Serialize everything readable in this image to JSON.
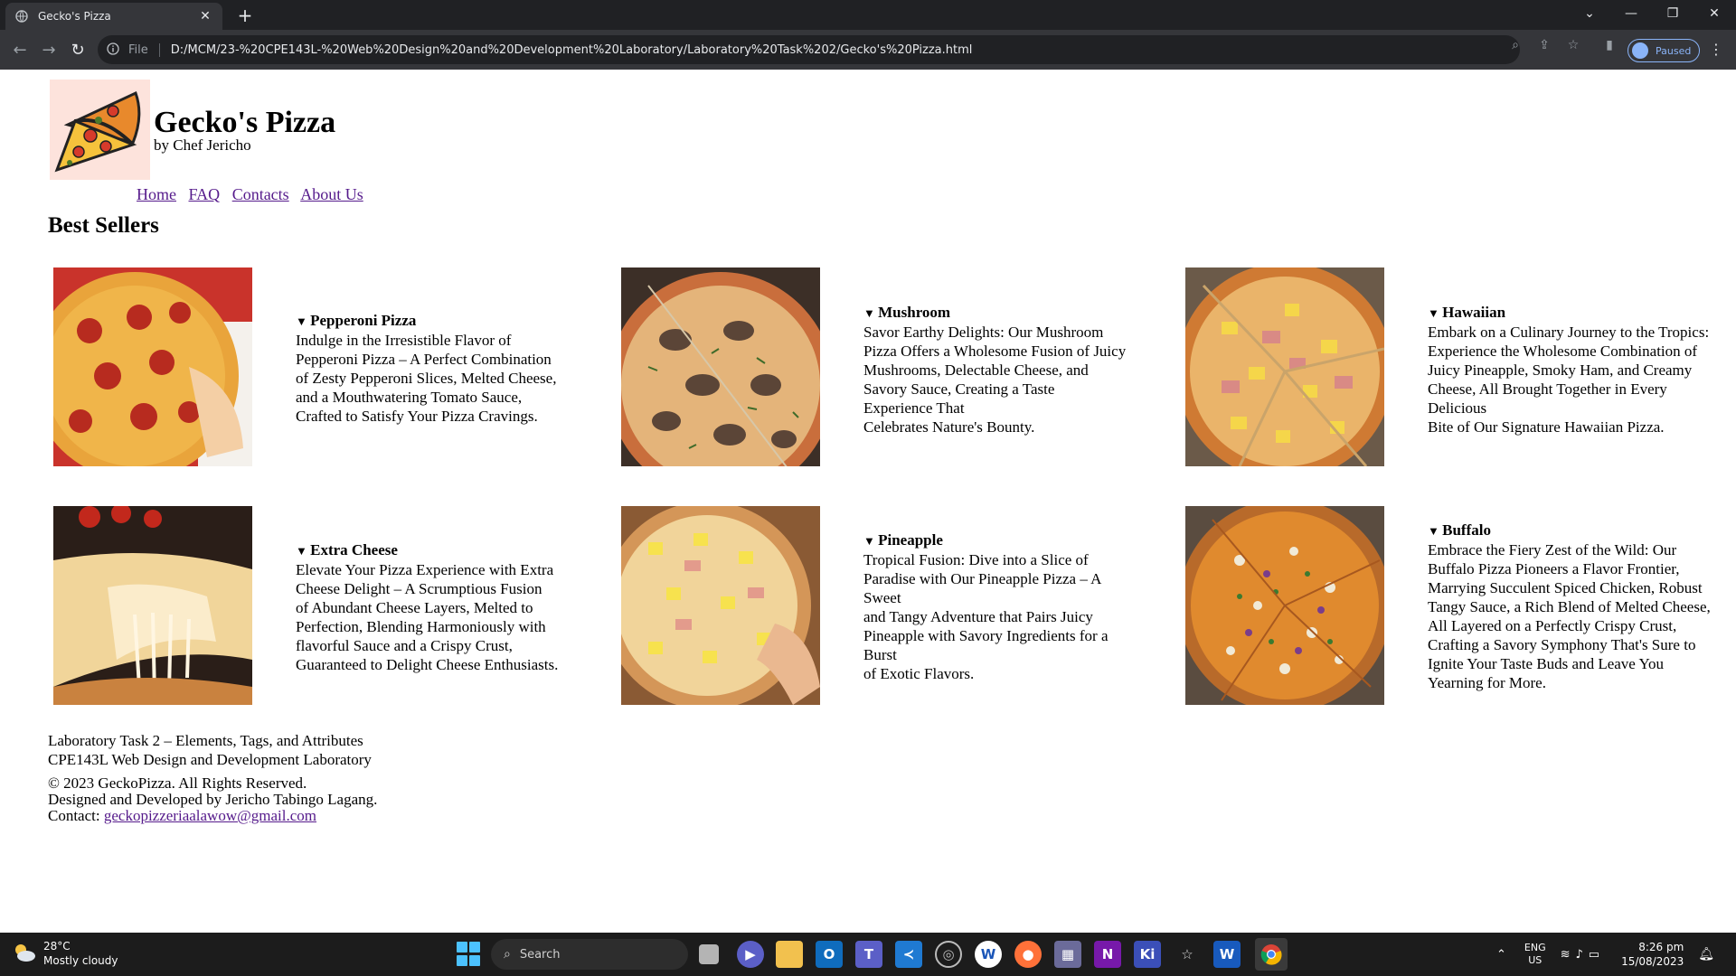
{
  "browser": {
    "tab_title": "Gecko's Pizza",
    "url_scheme": "File",
    "url": "D:/MCM/23-%20CPE143L-%20Web%20Design%20and%20Development%20Laboratory/Laboratory%20Task%202/Gecko's%20Pizza.html",
    "profile_status": "Paused"
  },
  "site": {
    "title": "Gecko's Pizza",
    "byline": "by Chef Jericho",
    "nav": [
      "Home",
      "FAQ",
      "Contacts",
      "About Us"
    ],
    "section_heading": "Best Sellers"
  },
  "pizzas": [
    {
      "name": "Pepperoni Pizza",
      "lines": [
        "Indulge in the Irresistible Flavor of",
        "Pepperoni Pizza – A Perfect Combination",
        "of Zesty Pepperoni Slices, Melted Cheese,",
        "and a Mouthwatering Tomato Sauce,",
        "Crafted to Satisfy Your Pizza Cravings."
      ]
    },
    {
      "name": "Mushroom",
      "lines": [
        "Savor Earthy Delights: Our Mushroom",
        "Pizza Offers a Wholesome Fusion of Juicy",
        "Mushrooms, Delectable Cheese, and",
        "Savory Sauce, Creating a Taste",
        "Experience That",
        "Celebrates Nature's Bounty."
      ]
    },
    {
      "name": "Hawaiian",
      "lines": [
        "Embark on a Culinary Journey to the Tropics:",
        "Experience the Wholesome Combination of",
        "Juicy Pineapple, Smoky Ham, and Creamy",
        "Cheese, All Brought Together in Every",
        "Delicious",
        "Bite of Our Signature Hawaiian Pizza."
      ]
    },
    {
      "name": "Extra Cheese",
      "lines": [
        "Elevate Your Pizza Experience with Extra",
        "Cheese Delight – A Scrumptious Fusion",
        "of Abundant Cheese Layers, Melted to",
        "Perfection, Blending Harmoniously with",
        "flavorful Sauce and a Crispy Crust,",
        "Guaranteed to Delight Cheese Enthusiasts."
      ]
    },
    {
      "name": "Pineapple",
      "lines": [
        "Tropical Fusion: Dive into a Slice of",
        "Paradise with Our Pineapple Pizza – A",
        "Sweet",
        "and Tangy Adventure that Pairs Juicy",
        "Pineapple with Savory Ingredients for a",
        "Burst",
        "of Exotic Flavors."
      ]
    },
    {
      "name": "Buffalo",
      "lines": [
        "Embrace the Fiery Zest of the Wild: Our",
        "Buffalo Pizza Pioneers a Flavor Frontier,",
        "Marrying Succulent Spiced Chicken, Robust",
        "Tangy Sauce, a Rich Blend of Melted Cheese,",
        "All Layered on a Perfectly Crispy Crust,",
        "Crafting a Savory Symphony That's Sure to",
        "Ignite Your Taste Buds and Leave You",
        "Yearning for More."
      ]
    }
  ],
  "footer": {
    "task": "Laboratory Task 2 – Elements, Tags, and Attributes",
    "course": "CPE143L Web Design and Development Laboratory",
    "copyright": "© 2023 GeckoPizza. All Rights Reserved.",
    "credit": "Designed and Developed by Jericho Tabingo Lagang.",
    "contact_label": "Contact:",
    "contact_email": "geckopizzeriaalawow@gmail.com"
  },
  "taskbar": {
    "temperature": "28°C",
    "weather": "Mostly cloudy",
    "search_placeholder": "Search",
    "lang_top": "ENG",
    "lang_bottom": "US",
    "time": "8:26 pm",
    "date": "15/08/2023"
  },
  "colors": {
    "link_visited": "#551a8b",
    "chrome_dark": "#202124",
    "chrome_toolbar": "#35363a",
    "accent_blue": "#8ab4f8"
  }
}
